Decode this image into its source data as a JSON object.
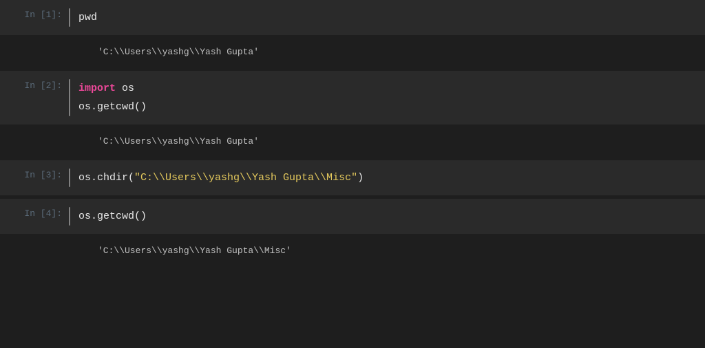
{
  "cells": [
    {
      "prompt": "In [1]:",
      "code_html": "<span class='func-call'>pwd</span>",
      "output": "'C:\\\\Users\\\\yashg\\\\Yash Gupta'"
    },
    {
      "prompt": "In [2]:",
      "code_html": "<span class='kw-import'>import</span> <span class='kw-module'>os</span><br><span class='func-call'>os.getcwd()</span>",
      "output": "'C:\\\\Users\\\\yashg\\\\Yash Gupta'"
    },
    {
      "prompt": "In [3]:",
      "code_html": "<span class='func-call'>os.chdir(</span><span class='string-lit'>\"C:\\\\Users\\\\yashg\\\\Yash Gupta\\\\Misc\"</span><span class='func-call'>)</span>",
      "output": null
    },
    {
      "prompt": "In [4]:",
      "code_html": "<span class='func-call'>os.getcwd()</span>",
      "output": "'C:\\\\Users\\\\yashg\\\\Yash Gupta\\\\Misc'"
    }
  ]
}
